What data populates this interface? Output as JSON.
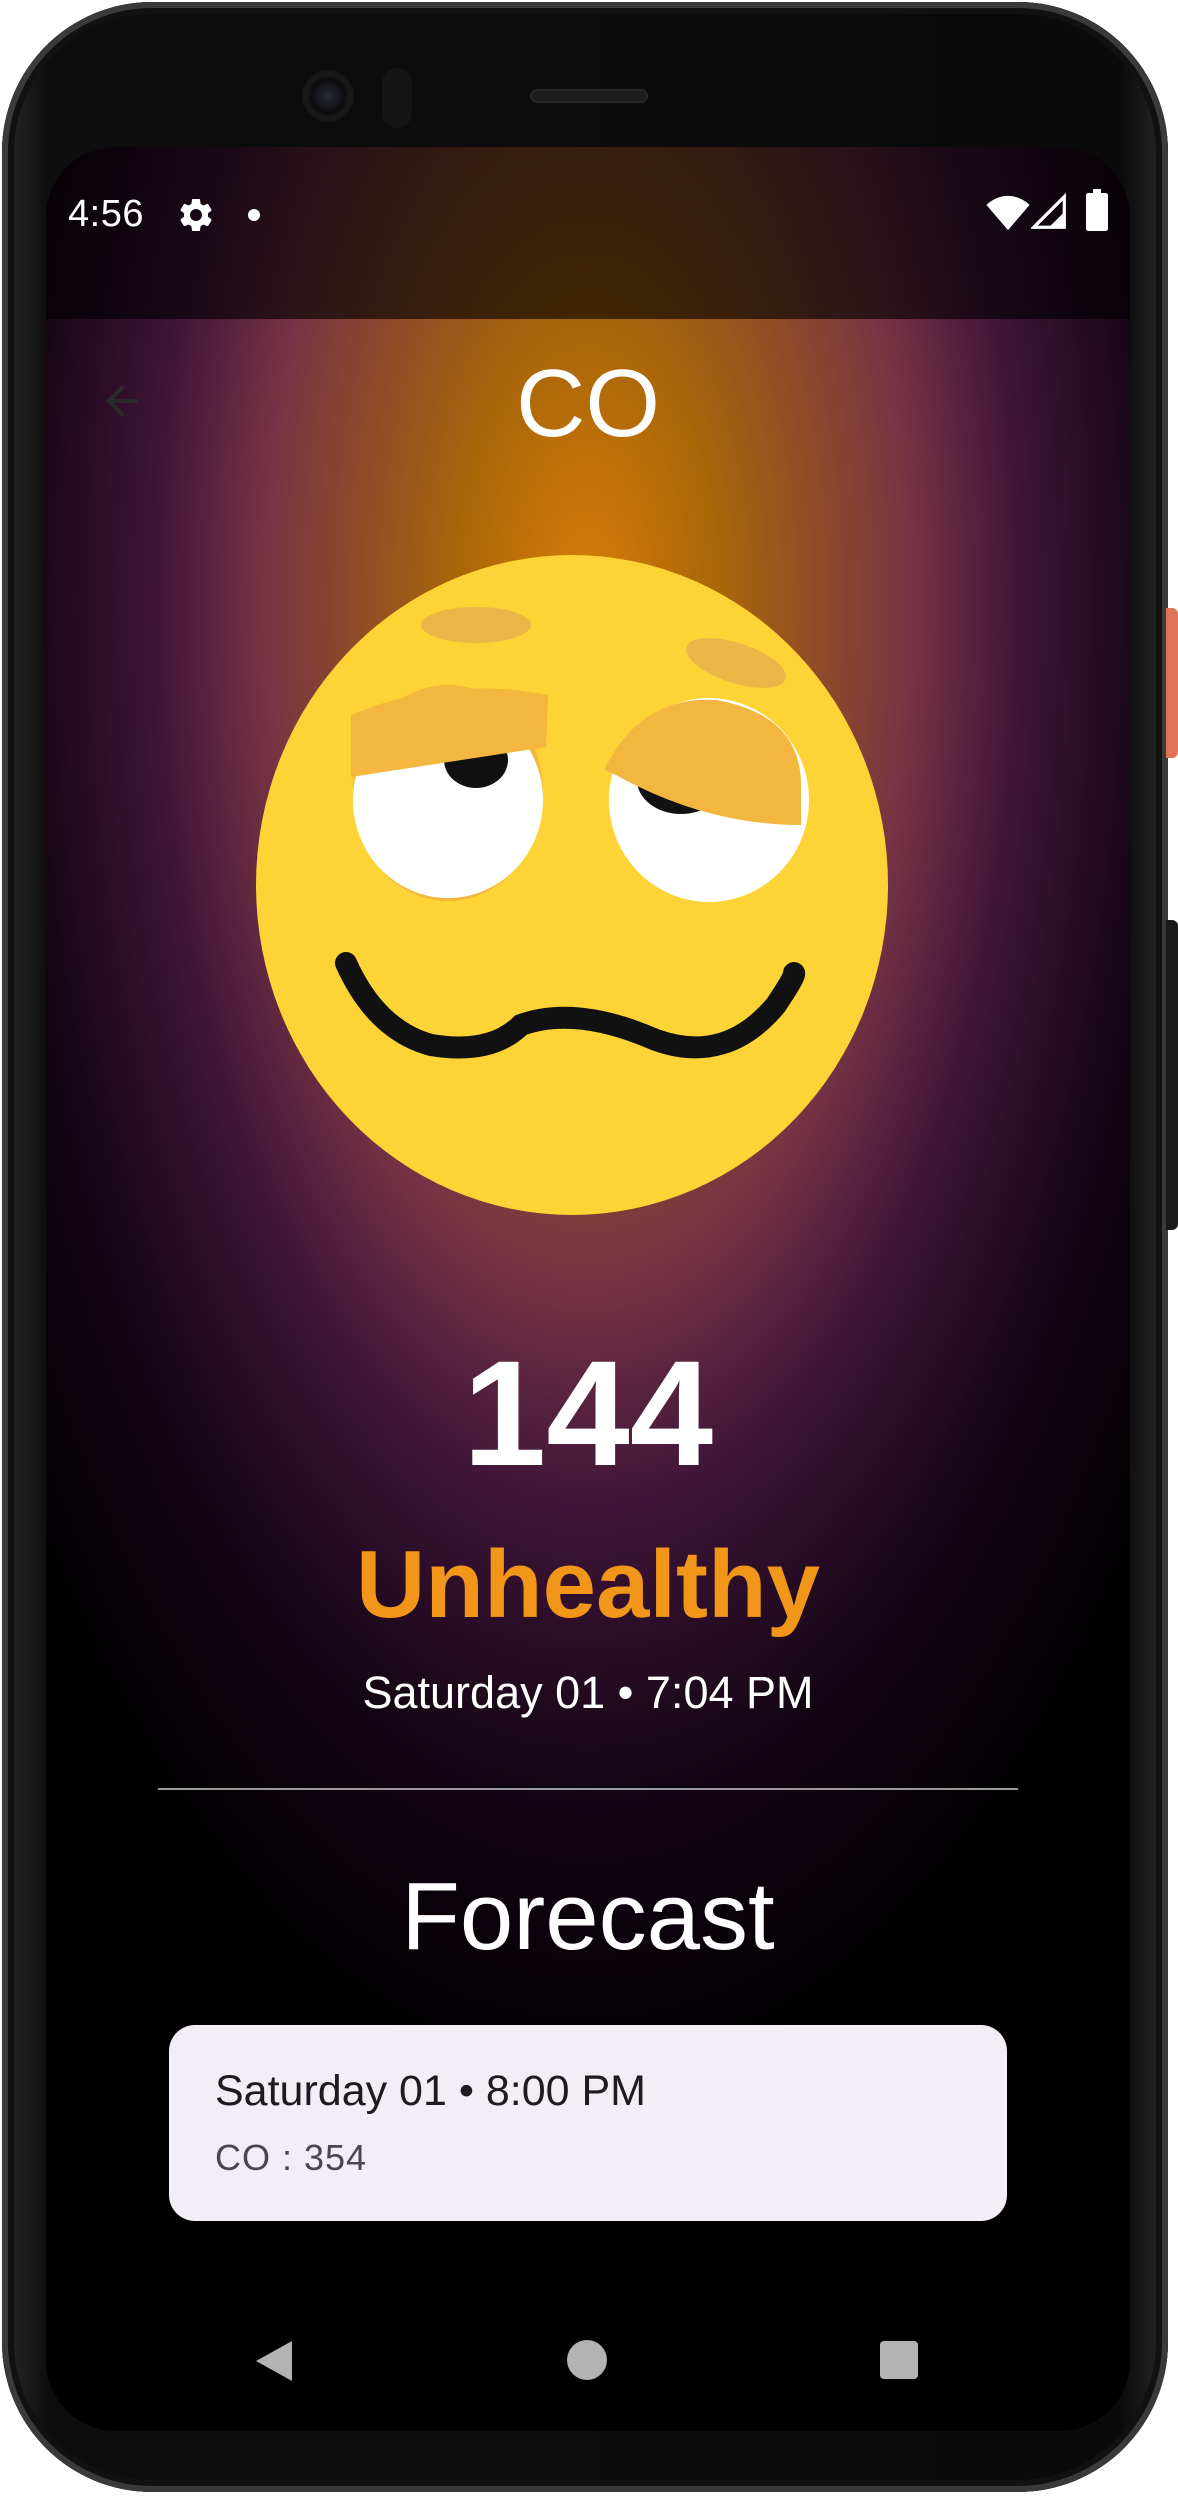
{
  "status_bar": {
    "time": "4:56",
    "icons": [
      "gear-icon",
      "notification-dot-icon",
      "wifi-icon",
      "cell-signal-icon",
      "battery-icon"
    ]
  },
  "header": {
    "back_icon": "arrow-left-icon",
    "title": "CO"
  },
  "current": {
    "emoji": "woozy-face-icon",
    "value": "144",
    "status": "Unhealthy",
    "status_color": "#f2961a",
    "datetime": "Saturday 01 • 7:04 PM"
  },
  "forecast": {
    "title": "Forecast",
    "items": [
      {
        "datetime": "Saturday 01 • 8:00 PM",
        "detail": "CO : 354"
      }
    ]
  },
  "nav_bar": {
    "icons": [
      "nav-back-icon",
      "nav-home-icon",
      "nav-recents-icon"
    ]
  },
  "colors": {
    "accent": "#f2961a",
    "card_bg": "#f3eef5",
    "emoji_face": "#fdd335"
  }
}
